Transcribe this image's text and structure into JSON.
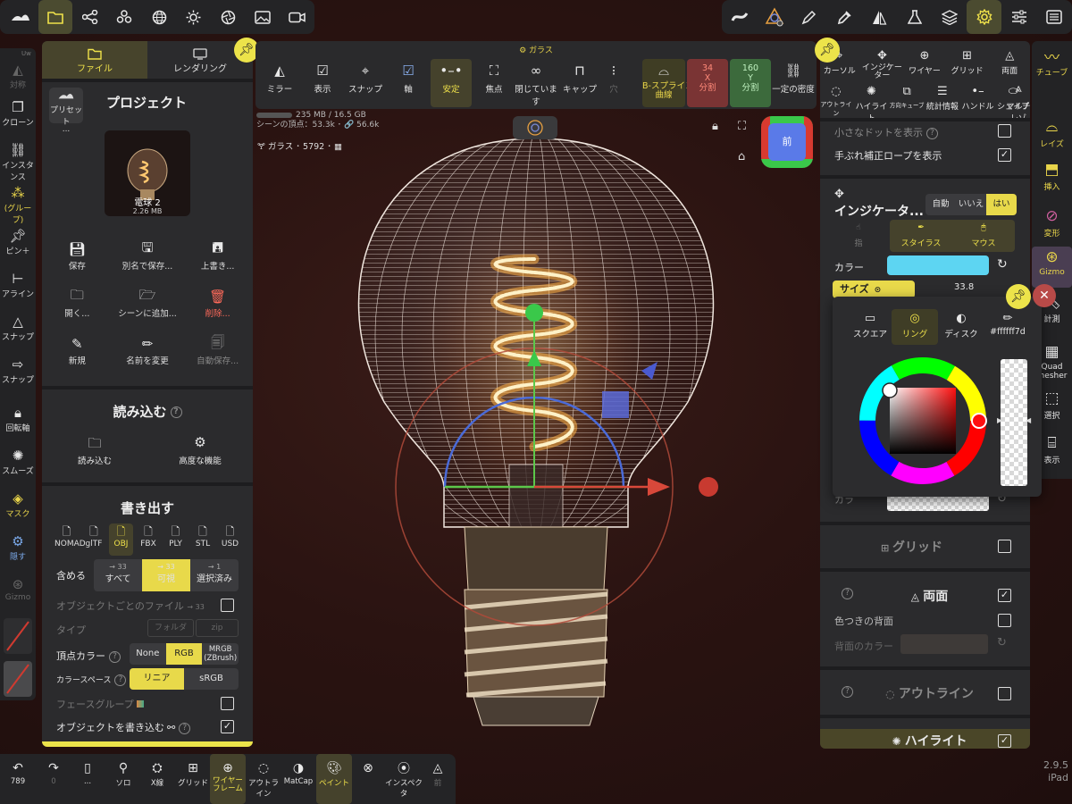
{
  "top_left_toolbar": {
    "items": [
      {
        "icon": "brand-icon"
      },
      {
        "icon": "folder-icon",
        "sub": "..."
      },
      {
        "icon": "scene-tree-icon"
      },
      {
        "icon": "materials-icon",
        "sub": "..."
      },
      {
        "icon": "sphere-grid-icon"
      },
      {
        "icon": "light-icon"
      },
      {
        "icon": "aperture-icon"
      },
      {
        "icon": "image-icon"
      },
      {
        "icon": "video-icon"
      }
    ]
  },
  "top_right_toolbar": {
    "items": [
      "stroke-icon",
      "pivot-icon",
      "brush-icon",
      "dropper-icon",
      "symmetry-icon",
      "flask-icon",
      "layers-icon",
      "gear-icon",
      "sliders-icon",
      "menu-icon"
    ]
  },
  "left_column": {
    "items": [
      {
        "label": "対称",
        "dim": true
      },
      {
        "label": "クローン"
      },
      {
        "label": "インスタンス"
      },
      {
        "label": "(グループ)"
      },
      {
        "label": "ピン＋"
      },
      {
        "label": "アライン"
      },
      {
        "label": "スナップ"
      },
      {
        "label": "スナップ"
      },
      {
        "label": "回転軸"
      },
      {
        "label": "スムーズ"
      },
      {
        "label": "マスク"
      },
      {
        "label": "隠す"
      },
      {
        "label": "Gizmo",
        "dim": true
      }
    ],
    "top_label": "Uw"
  },
  "file_panel": {
    "tabs": [
      {
        "label": "ファイル",
        "active": true
      },
      {
        "label": "レンダリング",
        "active": false
      }
    ],
    "preset_label": "プリセット",
    "preset_sub": "...",
    "project_title": "プロジェクト",
    "thumbnail": {
      "name": "電球 2",
      "size": "2.26 MB"
    },
    "actions": [
      {
        "label": "保存",
        "icon": "save-icon"
      },
      {
        "label": "別名で保存...",
        "icon": "save-as-icon"
      },
      {
        "label": "上書き...",
        "icon": "overwrite-icon"
      },
      {
        "label": "開く...",
        "icon": "open-folder-icon"
      },
      {
        "label": "シーンに追加...",
        "icon": "add-scene-icon"
      },
      {
        "label": "削除...",
        "icon": "trash-icon",
        "red": true
      },
      {
        "label": "新規",
        "icon": "new-icon"
      },
      {
        "label": "名前を変更",
        "icon": "rename-icon"
      },
      {
        "label": "自動保存...",
        "icon": "autosave-icon",
        "dim": true
      }
    ],
    "import_title": "読み込む",
    "import_actions": [
      {
        "label": "読み込む",
        "icon": "import-icon"
      },
      {
        "label": "高度な機能",
        "icon": "advanced-gear-icon"
      }
    ],
    "export_title": "書き出す",
    "formats": [
      {
        "label": "NOMAD"
      },
      {
        "label": "glTF"
      },
      {
        "label": "OBJ",
        "active": true
      },
      {
        "label": "FBX"
      },
      {
        "label": "PLY"
      },
      {
        "label": "STL"
      },
      {
        "label": "USD"
      }
    ],
    "include_label": "含める",
    "include_options": [
      {
        "count": "→ 33",
        "label": "すべて"
      },
      {
        "count": "→ 33",
        "label": "可視",
        "active": true
      },
      {
        "count": "→ 1",
        "label": "選択済み"
      }
    ],
    "per_object_label": "オブジェクトごとのファイル",
    "per_object_count": "→ 33",
    "type_label": "タイプ",
    "type_folder": "フォルダ",
    "type_zip": "zip",
    "vertex_color_label": "頂点カラー",
    "vertex_color_options": [
      "None",
      "RGB",
      "MRGB\n(ZBrush)"
    ],
    "colorspace_label": "カラースペース",
    "colorspace_options": [
      "リニア",
      "sRGB"
    ],
    "face_group_label": "フェースグループ",
    "write_objects_label": "オブジェクトを書き込む"
  },
  "mesh_toolbar": {
    "title": "ガラス",
    "items": [
      {
        "label": "ミラー",
        "icon": "mirror-icon"
      },
      {
        "label": "表示",
        "icon": "check-icon"
      },
      {
        "label": "スナップ",
        "icon": "snap-icon"
      },
      {
        "label": "軸",
        "icon": "axis-check-icon"
      },
      {
        "label": "安定",
        "icon": "stable-icon",
        "active": true
      },
      {
        "label": "焦点",
        "icon": "focus-icon"
      },
      {
        "label": "閉じています",
        "icon": "loop-icon"
      },
      {
        "label": "キャップ",
        "icon": "cap-icon"
      },
      {
        "label": "穴",
        "icon": "hole-icon",
        "dim": true
      },
      {
        "label": "B-スプライン\n曲線",
        "icon": "spline-icon",
        "style": "olive"
      },
      {
        "label": "X\n分割",
        "value": "34",
        "style": "red"
      },
      {
        "label": "Y\n分割",
        "value": "160",
        "style": "green"
      },
      {
        "label": "一定の密度",
        "icon": "link-icon"
      }
    ]
  },
  "stats": {
    "memory": "235 MB / 16.5 GB",
    "vertices": "シーンの頂点：53.3k ･ 🔗 56.6k",
    "object": "ガラス ･ 5792 ･"
  },
  "view_cube": {
    "label": "前"
  },
  "right_column": {
    "items": [
      {
        "label": "チューブ"
      },
      {
        "label": "レイズ"
      },
      {
        "label": "挿入"
      },
      {
        "label": "変形"
      },
      {
        "label": "Gizmo",
        "active": true
      },
      {
        "label": "計測",
        "white": true
      },
      {
        "label": "Quad\nmesher",
        "white": true
      },
      {
        "label": "選択",
        "white": true
      },
      {
        "label": "表示",
        "white": true
      }
    ]
  },
  "wire_panel": {
    "grid": [
      {
        "label": "カーソル",
        "icon": "cursor-icon"
      },
      {
        "label": "インジケーター",
        "icon": "indicator-icon"
      },
      {
        "label": "ワイヤー",
        "icon": "wire-icon"
      },
      {
        "label": "グリッド",
        "icon": "grid-icon"
      },
      {
        "label": "両面",
        "icon": "double-side-icon"
      },
      {
        "label": "アウトライン",
        "icon": "outline-icon",
        "small": true
      },
      {
        "label": "ハイライト",
        "icon": "highlight-icon"
      },
      {
        "label": "方向キューブ",
        "icon": "direction-cube-icon",
        "small": true
      },
      {
        "label": "統計情報",
        "icon": "stats-icon"
      },
      {
        "label": "ハンドル",
        "icon": "handle-icon"
      },
      {
        "label": "シェイプ",
        "icon": "shape-icon"
      },
      {
        "label": "マルチレゾ",
        "icon": "multires-icon"
      }
    ],
    "show_small_dots": "小さなドットを表示",
    "show_smooth_rope": "手ぶれ補正ロープを表示",
    "indicator_title": "インジケータ...",
    "indicator_options": [
      "自動",
      "いいえ",
      "はい"
    ],
    "input_options": [
      {
        "label": "指",
        "dim": true
      },
      {
        "label": "スタイラス",
        "active": true
      },
      {
        "label": "マウス",
        "active": true
      }
    ],
    "color_label": "カラー",
    "color_value": "#5dd5f2",
    "size_label": "サイズ",
    "size_value": "33.8",
    "grid_title": "グリッド",
    "double_title": "両面",
    "colored_back": "色つきの背面",
    "back_color": "背面のカラー",
    "outline_title": "アウトライン",
    "highlight_title": "ハイライト",
    "cropped_color": "カラ"
  },
  "color_picker": {
    "options": [
      {
        "label": "スクエア",
        "icon": "square-icon"
      },
      {
        "label": "リング",
        "icon": "ring-icon",
        "active": true
      },
      {
        "label": "ディスク",
        "icon": "disc-icon"
      },
      {
        "label": "#ffffff7d",
        "icon": "pencil-icon"
      }
    ]
  },
  "bottom_bar": {
    "items": [
      {
        "label": "789",
        "icon": "undo-icon"
      },
      {
        "label": "0",
        "icon": "redo-icon",
        "dim": true
      },
      {
        "label": "...",
        "icon": "phone-icon"
      },
      {
        "label": "ソロ",
        "icon": "search-icon"
      },
      {
        "label": "X線",
        "icon": "xray-icon"
      },
      {
        "label": "グリッド",
        "icon": "grid-icon"
      },
      {
        "label": "ワイヤーフレーム",
        "icon": "wireframe-icon",
        "active": true
      },
      {
        "label": "アウトライン",
        "icon": "outline-icon"
      },
      {
        "label": "MatCap",
        "icon": "matcap-icon"
      },
      {
        "label": "ペイント",
        "icon": "paint-icon",
        "active": true
      },
      {
        "label": "",
        "icon": "disabled-icon",
        "dim": true
      },
      {
        "label": "インスペクタ",
        "icon": "inspector-icon"
      },
      {
        "label": "前",
        "icon": "front-icon",
        "dim": true
      }
    ]
  },
  "version": {
    "number": "2.9.5",
    "device": "iPad"
  }
}
